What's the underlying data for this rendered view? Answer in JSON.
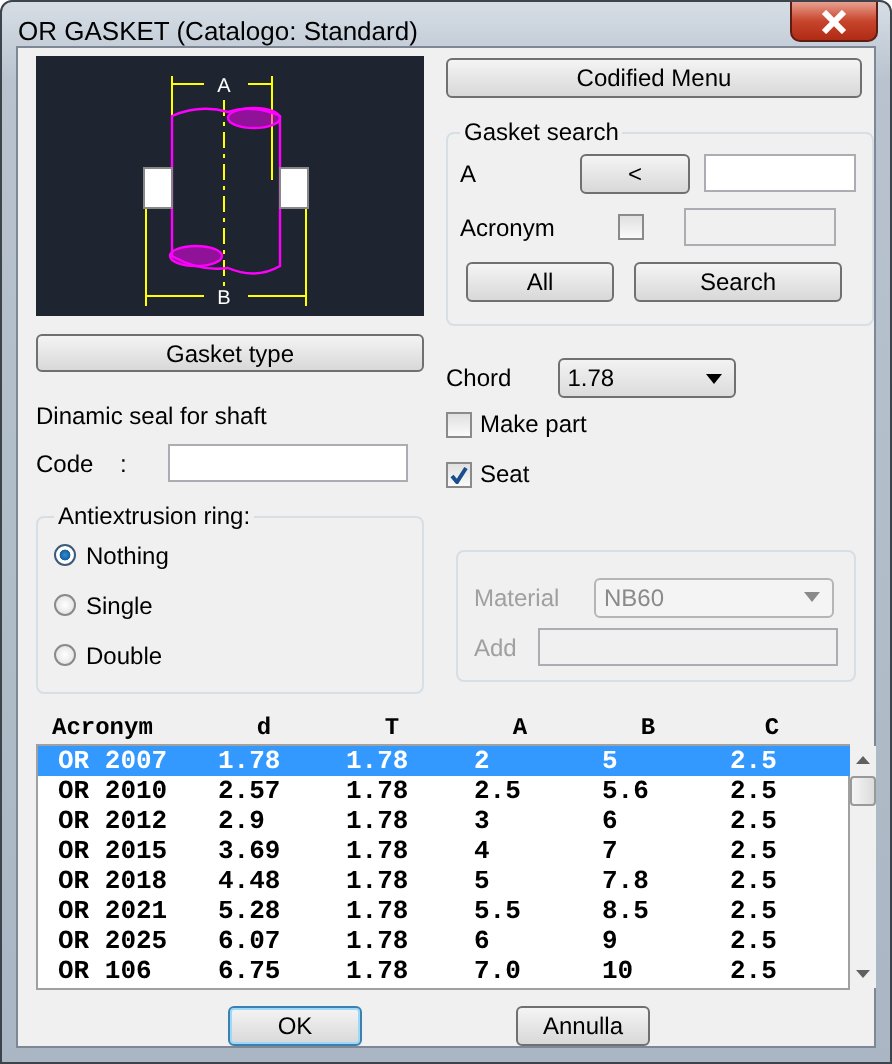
{
  "window": {
    "title": "OR GASKET (Catalogo: Standard)"
  },
  "drawing": {
    "labels": [
      "A",
      "B"
    ]
  },
  "codified_menu_button": "Codified Menu",
  "gasket_search": {
    "title": "Gasket search",
    "a_label": "A",
    "a_button": "<",
    "acronym_label": "Acronym",
    "acronym_checked": false,
    "buttons": [
      "All",
      "Search"
    ]
  },
  "gasket_type_button": "Gasket type",
  "description": "Dinamic seal for shaft",
  "code": {
    "label": "Code",
    "separator": ":"
  },
  "antiextrusion": {
    "title": "Antiextrusion ring:",
    "options": [
      {
        "label": "Nothing",
        "selected": true
      },
      {
        "label": "Single",
        "selected": false
      },
      {
        "label": "Double",
        "selected": false
      }
    ]
  },
  "chord": {
    "label": "Chord",
    "value": "1.78"
  },
  "options": [
    {
      "label": "Make part",
      "checked": false
    },
    {
      "label": "Seat",
      "checked": true
    }
  ],
  "material": {
    "disabled": true,
    "label": "Material",
    "value": "NB60",
    "add_label": "Add"
  },
  "table": {
    "columns": [
      "Acronym",
      "d",
      "T",
      "A",
      "B",
      "C"
    ],
    "rows": [
      {
        "cells": [
          "OR 2007",
          "1.78",
          "1.78",
          "2",
          "5",
          "2.5"
        ],
        "selected": true
      },
      {
        "cells": [
          "OR 2010",
          "2.57",
          "1.78",
          "2.5",
          "5.6",
          "2.5"
        ],
        "selected": false
      },
      {
        "cells": [
          "OR 2012",
          "2.9",
          "1.78",
          "3",
          "6",
          "2.5"
        ],
        "selected": false
      },
      {
        "cells": [
          "OR 2015",
          "3.69",
          "1.78",
          "4",
          "7",
          "2.5"
        ],
        "selected": false
      },
      {
        "cells": [
          "OR 2018",
          "4.48",
          "1.78",
          "5",
          "7.8",
          "2.5"
        ],
        "selected": false
      },
      {
        "cells": [
          "OR 2021",
          "5.28",
          "1.78",
          "5.5",
          "8.5",
          "2.5"
        ],
        "selected": false
      },
      {
        "cells": [
          "OR 2025",
          "6.07",
          "1.78",
          "6",
          "9",
          "2.5"
        ],
        "selected": false
      },
      {
        "cells": [
          "OR 106",
          "6.75",
          "1.78",
          "7.0",
          "10",
          "2.5"
        ],
        "selected": false
      }
    ]
  },
  "buttons": [
    {
      "label": "OK",
      "default": true
    },
    {
      "label": "Annulla",
      "default": false
    }
  ]
}
